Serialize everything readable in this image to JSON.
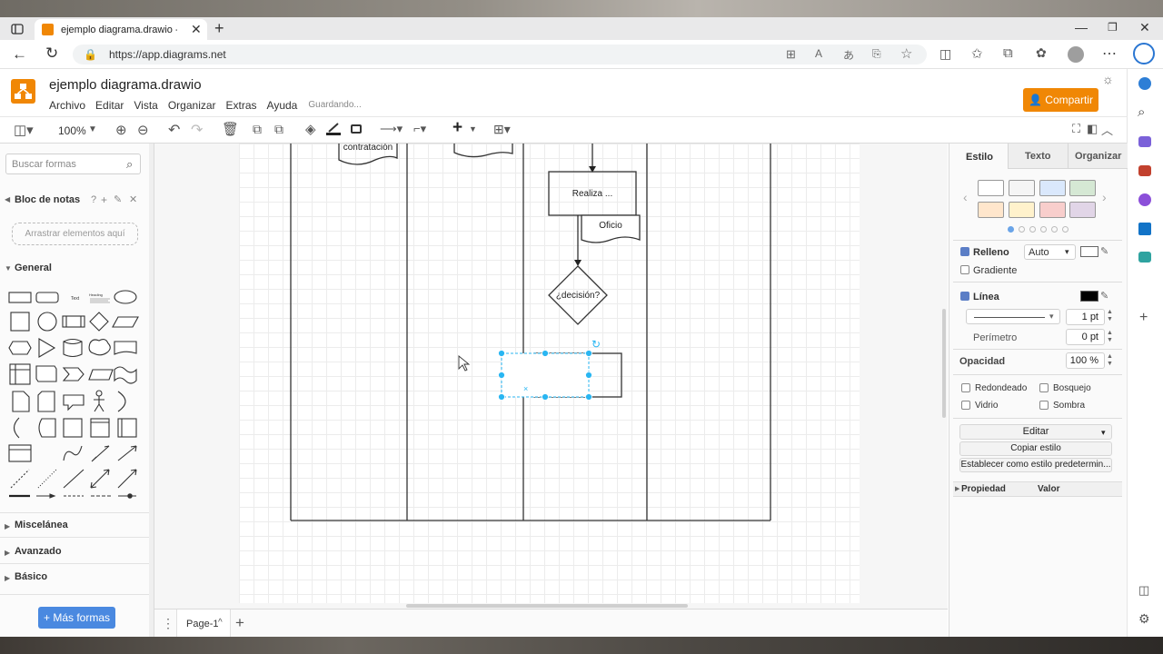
{
  "browser": {
    "tab_title": "ejemplo diagrama.drawio - draw",
    "url": "https://app.diagrams.net"
  },
  "app": {
    "title": "ejemplo diagrama.drawio",
    "menus": [
      "Archivo",
      "Editar",
      "Vista",
      "Organizar",
      "Extras",
      "Ayuda"
    ],
    "status": "Guardando...",
    "share_label": "Compartir",
    "zoom": "100%",
    "accent_color": "#f08705"
  },
  "left_panel": {
    "search_placeholder": "Buscar formas",
    "notes_title": "Bloc de notas",
    "notes_drop": "Arrastrar elementos aquí",
    "general": "General",
    "sections": [
      "Miscelánea",
      "Avanzado",
      "Básico"
    ],
    "more_shapes": "+ Más formas",
    "text_shape": "Text",
    "heading_shape": "Heading"
  },
  "diagram": {
    "label_contratacion": "contratación",
    "label_realiza": "Realiza ...",
    "label_oficio": "Oficio",
    "label_decision": "¿decisión?"
  },
  "page_bar": {
    "page_name": "Page-1"
  },
  "format_panel": {
    "tabs": [
      "Estilo",
      "Texto",
      "Organizar"
    ],
    "relleno": "Relleno",
    "relleno_value": "Auto",
    "gradiente": "Gradiente",
    "linea": "Línea",
    "linea_width": "1 pt",
    "perimetro": "Perímetro",
    "perimetro_value": "0 pt",
    "opacidad": "Opacidad",
    "opacidad_value": "100 %",
    "redondeado": "Redondeado",
    "bosquejo": "Bosquejo",
    "vidrio": "Vidrio",
    "sombra": "Sombra",
    "editar": "Editar",
    "copiar_estilo": "Copiar estilo",
    "establecer": "Establecer como estilo predetermin...",
    "propiedad": "Propiedad",
    "valor": "Valor",
    "swatches": [
      "#ffffff",
      "#f5f5f5",
      "#dae8fc",
      "#d5e8d4",
      "#ffe6cc",
      "#fff2cc",
      "#f8cecc",
      "#e1d5e7"
    ]
  }
}
